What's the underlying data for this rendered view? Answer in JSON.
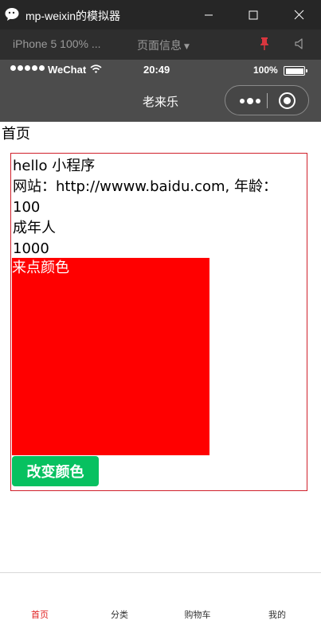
{
  "window": {
    "title": "mp-weixin的模拟器",
    "icons": {
      "app": "wechat-bubble-icon",
      "minimize": "minimize-icon",
      "maximize": "maximize-icon",
      "close": "close-icon"
    }
  },
  "simulator_toolbar": {
    "device_label": "iPhone 5 100% ...",
    "page_info_label": "页面信息",
    "icons": {
      "dropdown": "caret-down-icon",
      "pin": "pin-icon",
      "speaker": "speaker-icon"
    },
    "pin_color": "#d9363e"
  },
  "status_bar": {
    "carrier": "WeChat",
    "time": "20:49",
    "battery": "100%",
    "battery_level": 1.0,
    "signal_dots": 5
  },
  "nav_bar": {
    "title": "老来乐",
    "background": "#4c4c4c",
    "icons": {
      "more": "more-dots-icon",
      "close": "capsule-close-icon"
    }
  },
  "page": {
    "heading": "首页",
    "border_color": "#d0202a",
    "lines": [
      "hello 小程序",
      "网站：http://wwww.baidu.com, 年龄：",
      "100",
      "成年人",
      "1000"
    ],
    "color_block_text": "来点颜色",
    "color_block_bg": "#ff0000",
    "change_button_label": "改变颜色",
    "change_button_color": "#07c160"
  },
  "tab_bar": {
    "active_color": "#e02020",
    "tabs": [
      {
        "label": "首页",
        "active": true
      },
      {
        "label": "分类",
        "active": false
      },
      {
        "label": "购物车",
        "active": false
      },
      {
        "label": "我的",
        "active": false
      }
    ]
  }
}
